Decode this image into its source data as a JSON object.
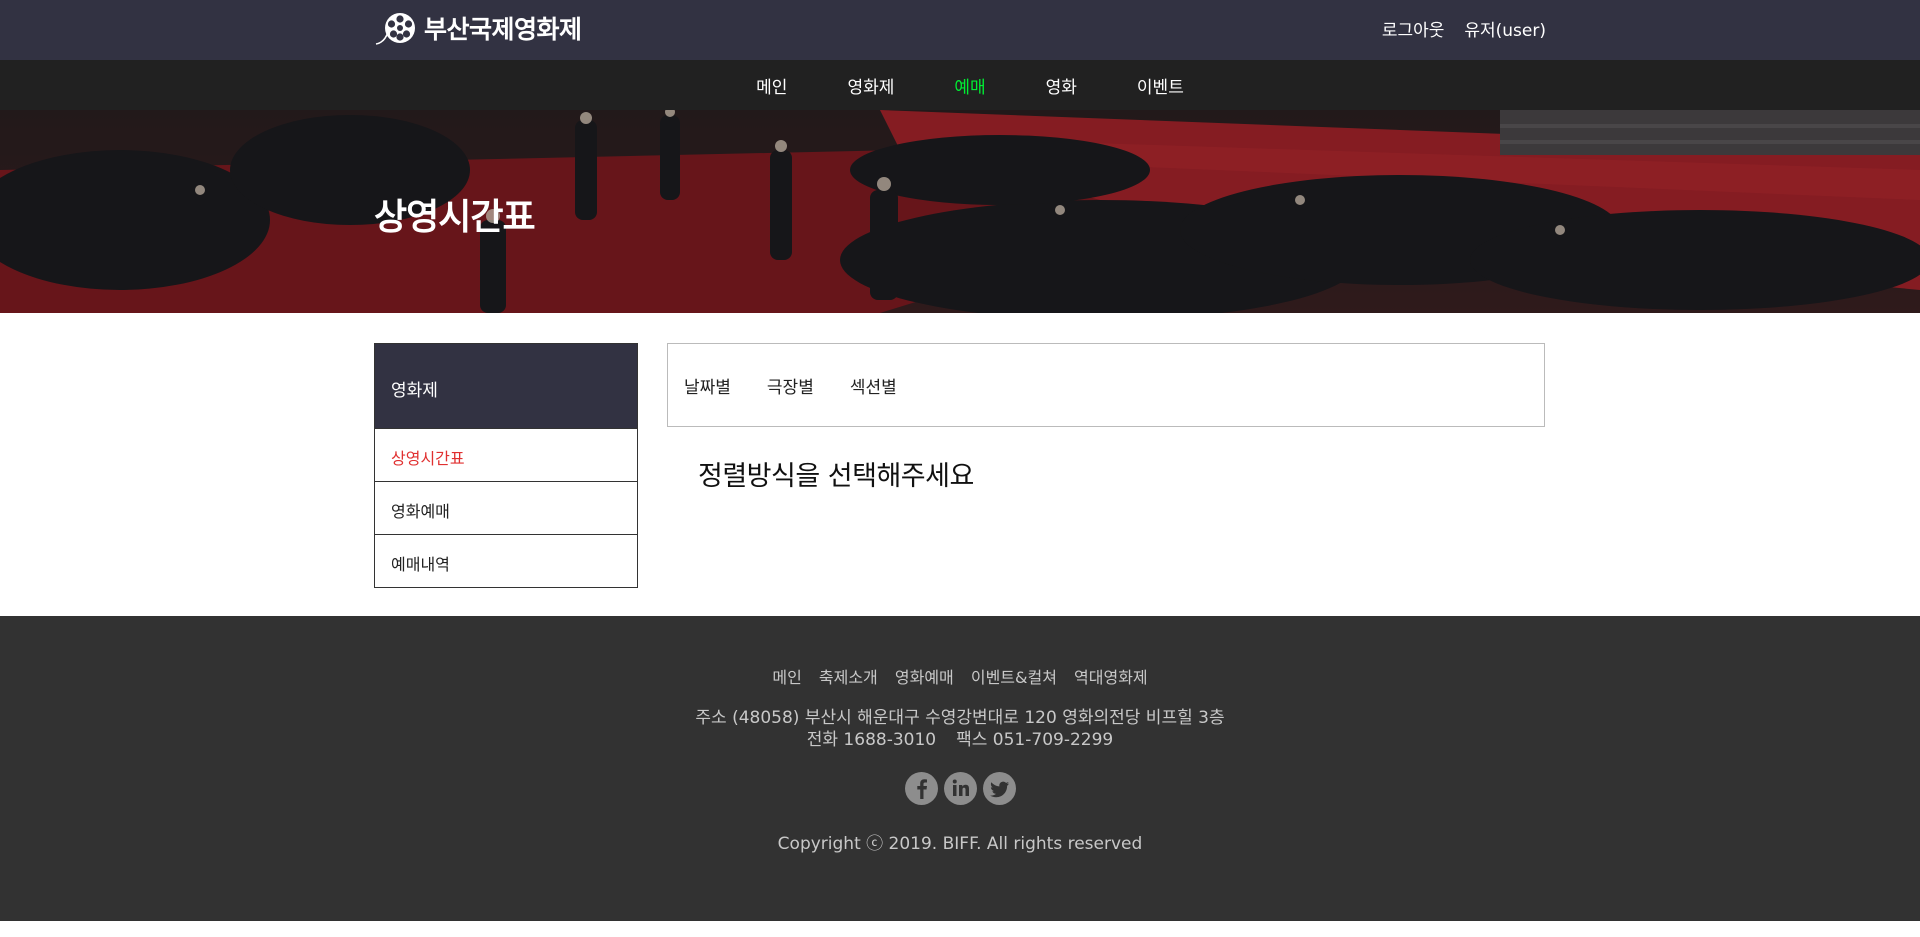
{
  "header": {
    "logo_text": "부산국제영화제",
    "logout_label": "로그아웃",
    "user_label": "유저(user)"
  },
  "nav": {
    "items": [
      "메인",
      "영화제",
      "예매",
      "영화",
      "이벤트"
    ],
    "active_index": 2,
    "active_color": "#00ee33"
  },
  "hero": {
    "title": "상영시간표"
  },
  "sidebar": {
    "heading": "영화제",
    "items": [
      "상영시간표",
      "영화예매",
      "예매내역"
    ],
    "active_color": "#e03030"
  },
  "tabs": {
    "items": [
      "날짜별",
      "극장별",
      "섹션별"
    ]
  },
  "main": {
    "prompt": "정렬방식을 선택해주세요"
  },
  "footer": {
    "links": [
      "메인",
      "축제소개",
      "영화예매",
      "이벤트&컬쳐",
      "역대영화제"
    ],
    "address": "주소 (48058) 부산시 해운대구 수영강변대로 120 영화의전당 비프힐 3층",
    "phone": "전화 1688-3010",
    "fax": "팩스 051-709-2299",
    "social_icons": [
      "facebook-icon",
      "linkedin-icon",
      "twitter-icon"
    ],
    "copyright": "Copyright ⓒ 2019. BIFF. All rights reserved"
  },
  "colors": {
    "topbar": "#323242",
    "nav_bg": "#212121",
    "footer_bg": "#323232",
    "red_carpet": "#8e1e24"
  }
}
